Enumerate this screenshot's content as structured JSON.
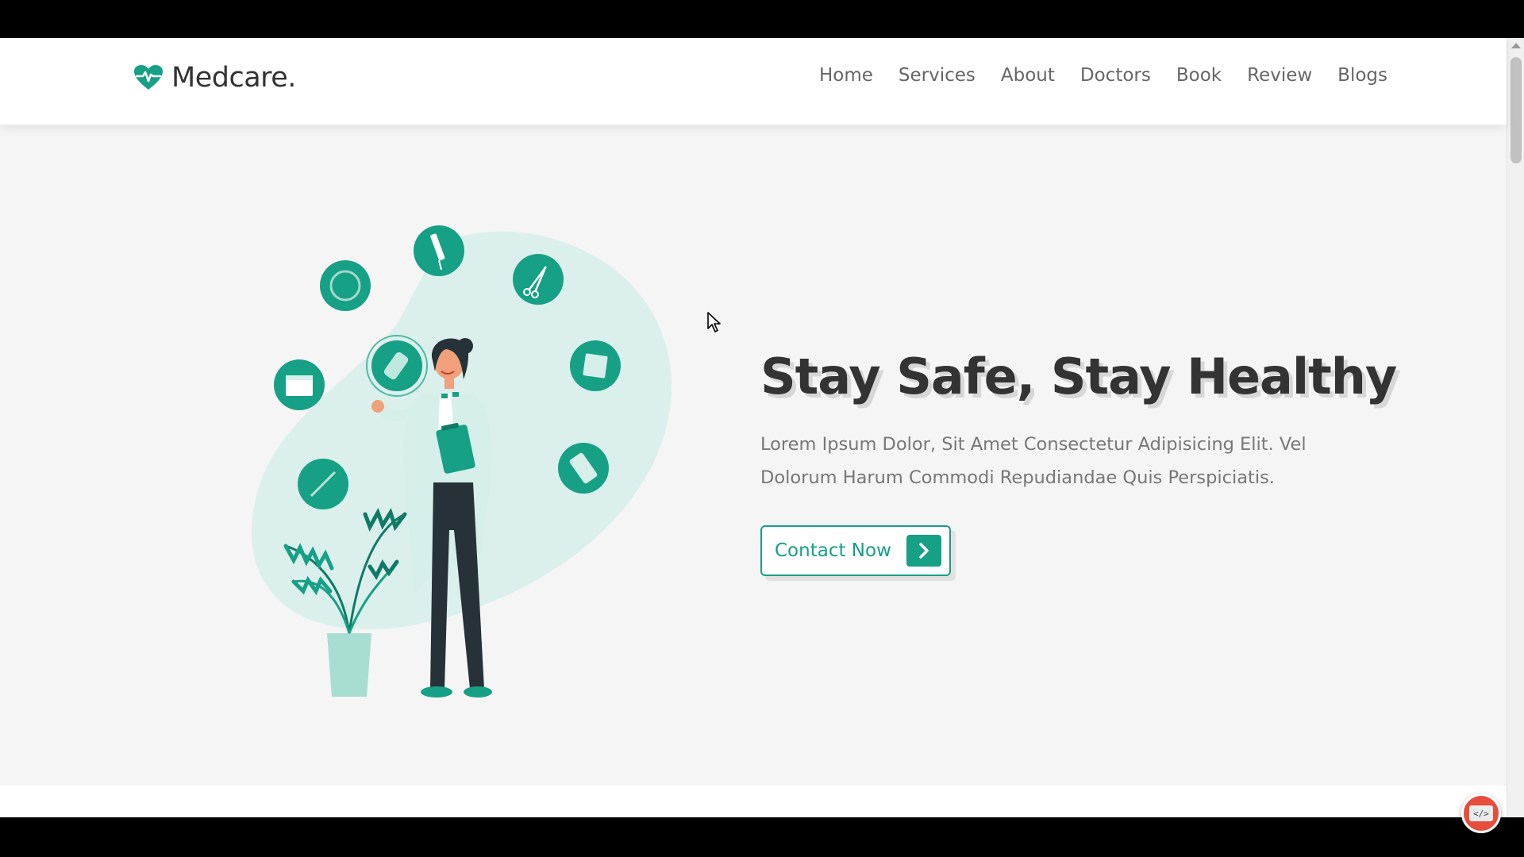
{
  "brand": {
    "name": "Medcare.",
    "icon": "heart-pulse-icon",
    "accent_color": "#16a085"
  },
  "nav": {
    "items": [
      {
        "label": "Home"
      },
      {
        "label": "Services"
      },
      {
        "label": "About"
      },
      {
        "label": "Doctors"
      },
      {
        "label": "Book"
      },
      {
        "label": "Review"
      },
      {
        "label": "Blogs"
      }
    ]
  },
  "hero": {
    "title": "Stay Safe, Stay Healthy",
    "description": "Lorem Ipsum Dolor, Sit Amet Consectetur Adipisicing Elit. Vel Dolorum Harum Commodi Repudiandae Quis Perspiciatis.",
    "cta_label": "Contact Now",
    "cta_icon": "chevron-right-icon",
    "illustration": "doctor-with-medical-icons-illustration"
  },
  "overlay": {
    "badge_text": "</>",
    "badge_icon": "code-icon"
  }
}
